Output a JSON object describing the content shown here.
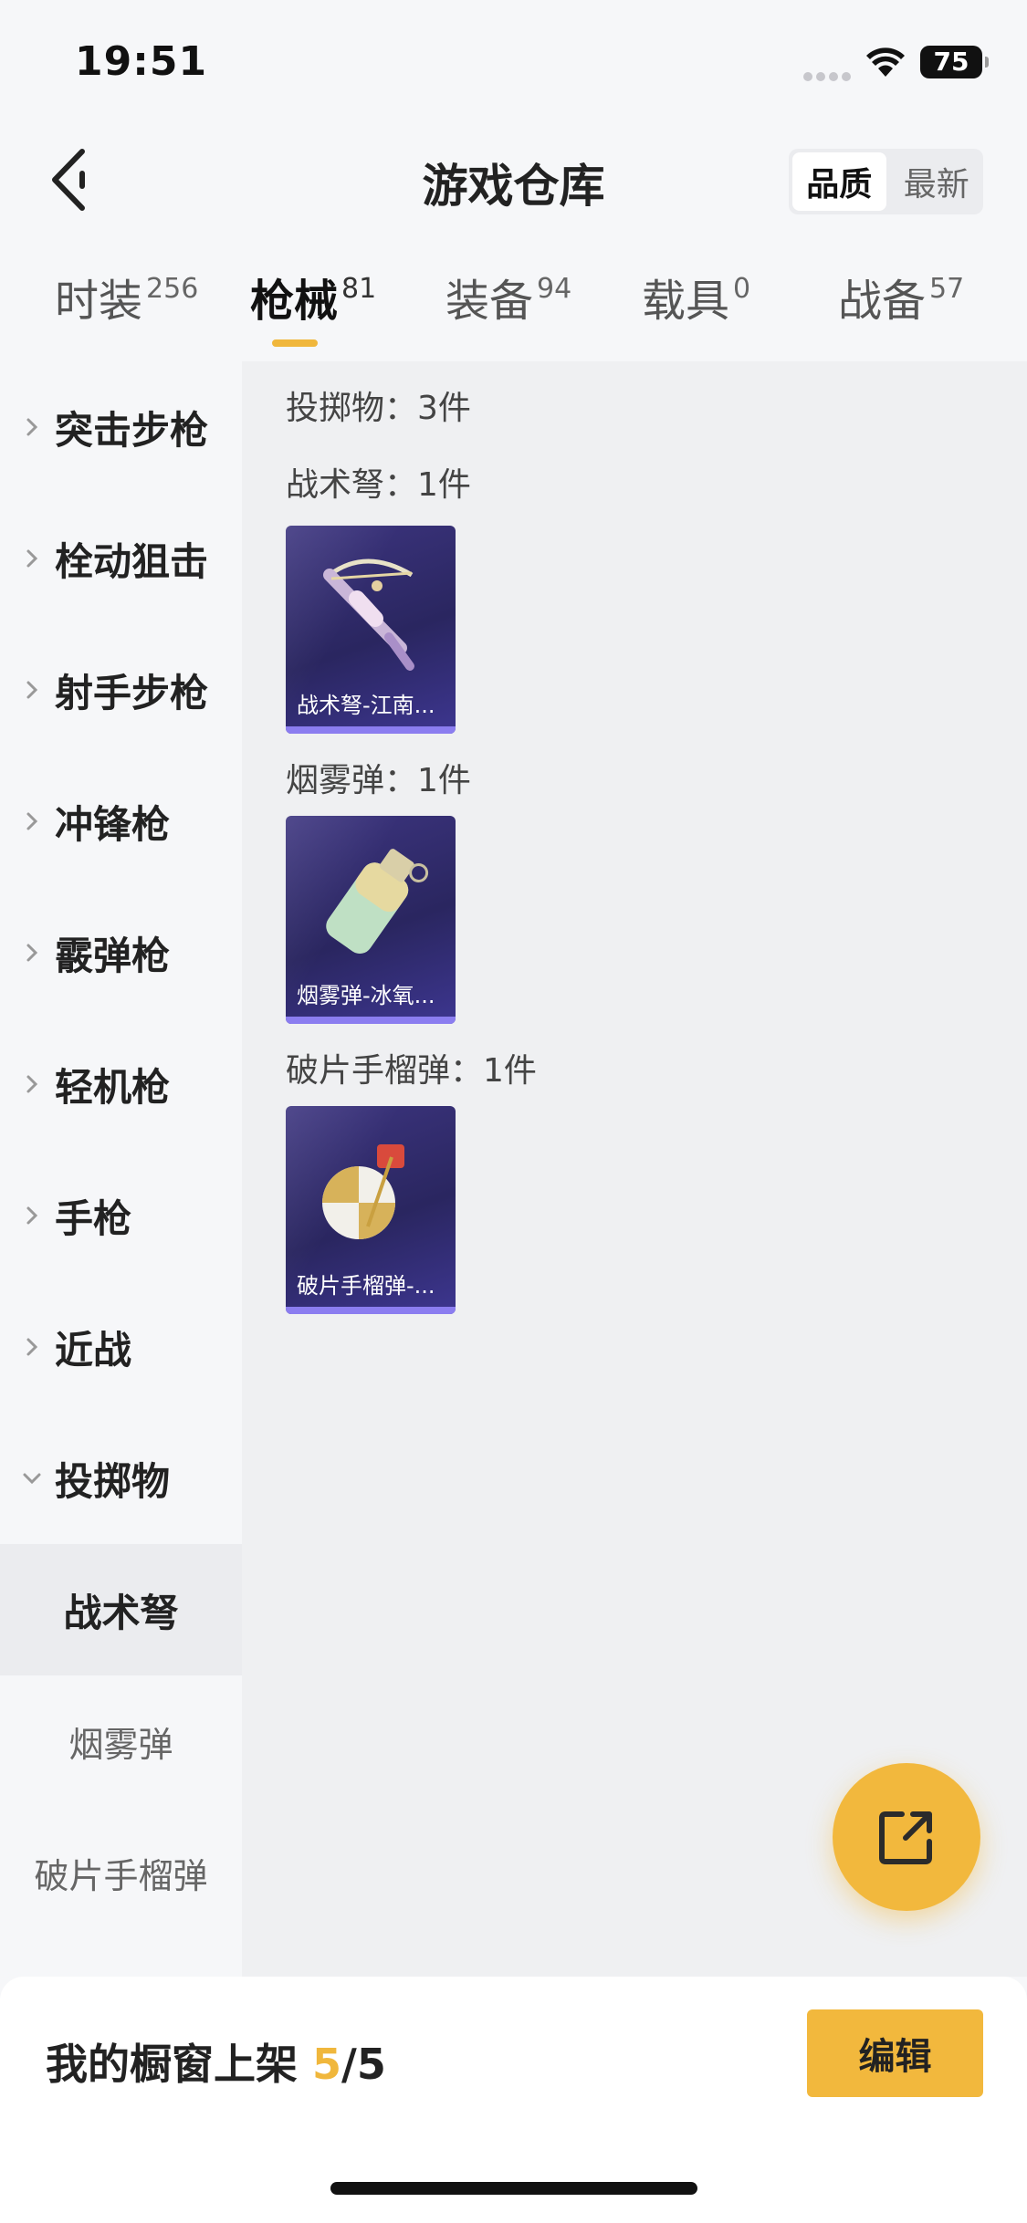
{
  "status_bar": {
    "time": "19:51",
    "battery": "75"
  },
  "header": {
    "title": "游戏仓库",
    "sort_options": [
      "品质",
      "最新"
    ],
    "active_sort": "品质"
  },
  "tabs": [
    {
      "label": "时装",
      "count": "256"
    },
    {
      "label": "枪械",
      "count": "81"
    },
    {
      "label": "装备",
      "count": "94"
    },
    {
      "label": "载具",
      "count": "0"
    },
    {
      "label": "战备",
      "count": "57"
    }
  ],
  "active_tab": "枪械",
  "sidebar": {
    "categories": [
      "突击步枪",
      "栓动狙击",
      "射手步枪",
      "冲锋枪",
      "霰弹枪",
      "轻机枪",
      "手枪",
      "近战",
      "投掷物"
    ],
    "expanded": "投掷物",
    "subcategories": [
      "战术弩",
      "烟雾弹",
      "破片手榴弹"
    ],
    "active_sub": "战术弩"
  },
  "content": {
    "summary": "投掷物：3件",
    "groups": [
      {
        "title": "战术弩：1件",
        "item_name": "战术弩-江南...",
        "icon": "crossbow-icon"
      },
      {
        "title": "烟雾弹：1件",
        "item_name": "烟雾弹-冰氧...",
        "icon": "smoke-grenade-icon"
      },
      {
        "title": "破片手榴弹：1件",
        "item_name": "破片手榴弹-...",
        "icon": "frag-grenade-icon"
      }
    ]
  },
  "bottom_bar": {
    "label": "我的橱窗上架",
    "current": "5",
    "total": "/5",
    "edit_label": "编辑"
  },
  "colors": {
    "accent": "#f2b83d",
    "card": "#2f2a6a",
    "card_stripe": "#8b7df0"
  }
}
